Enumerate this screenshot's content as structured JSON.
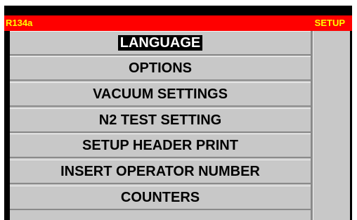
{
  "header": {
    "refrigerant": "R134a",
    "mode": "SETUP",
    "colors": {
      "background": "#ff0000",
      "text": "#ffff00"
    }
  },
  "menu": {
    "selected_index": 0,
    "items": [
      {
        "label": "LANGUAGE"
      },
      {
        "label": "OPTIONS"
      },
      {
        "label": "VACUUM SETTINGS"
      },
      {
        "label": "N2 TEST SETTING"
      },
      {
        "label": "SETUP HEADER PRINT"
      },
      {
        "label": "INSERT OPERATOR NUMBER"
      },
      {
        "label": "COUNTERS"
      }
    ]
  }
}
